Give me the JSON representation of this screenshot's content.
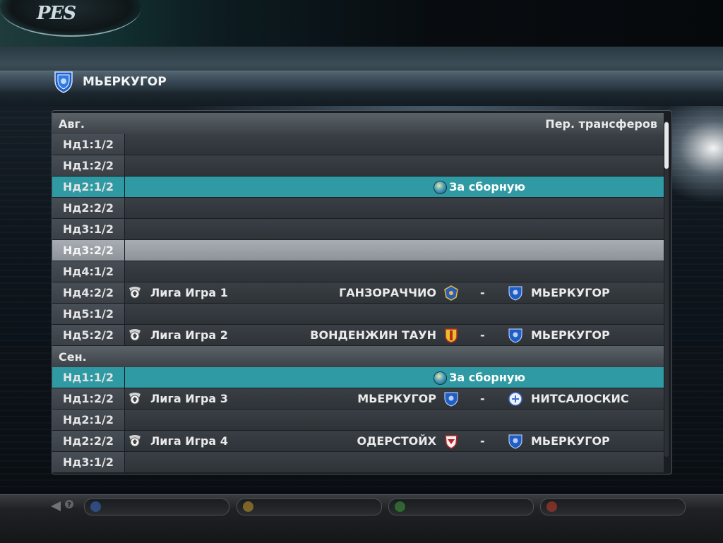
{
  "header": {
    "logo_text": "PES",
    "team_name": "МЬЕРКУГОР"
  },
  "months": [
    {
      "label": "Авг.",
      "window_label": "Пер. трансферов"
    },
    {
      "label": "Сен."
    }
  ],
  "rows": [
    {
      "week": "Нд1:1/2"
    },
    {
      "week": "Нд1:2/2"
    },
    {
      "week": "Нд2:1/2",
      "event": "За сборную",
      "style": "highlight"
    },
    {
      "week": "Нд2:2/2"
    },
    {
      "week": "Нд3:1/2"
    },
    {
      "week": "Нд3:2/2",
      "style": "selected"
    },
    {
      "week": "Нд4:1/2"
    },
    {
      "week": "Нд4:2/2",
      "competition": "Лига Игра 1",
      "home": "ГАНЗОРАЧЧИО",
      "away": "МЬЕРКУГОР"
    },
    {
      "week": "Нд5:1/2"
    },
    {
      "week": "Нд5:2/2",
      "competition": "Лига Игра 2",
      "home": "ВОНДЕНЖИН ТАУН",
      "away": "МЬЕРКУГОР"
    },
    {
      "week": "Нд1:1/2",
      "event": "За сборную",
      "style": "highlight"
    },
    {
      "week": "Нд1:2/2",
      "competition": "Лига Игра 3",
      "home": "МЬЕРКУГОР",
      "away": "НИТСАЛОСКИС"
    },
    {
      "week": "Нд2:1/2"
    },
    {
      "week": "Нд2:2/2",
      "competition": "Лига Игра 4",
      "home": "ОДЕРСТОЙХ",
      "away": "МЬЕРКУГОР"
    },
    {
      "week": "Нд3:1/2"
    }
  ],
  "match_separator": "-",
  "colors": {
    "highlight": "#2f9aa3",
    "selected": "#9aa0a5",
    "row": "#34393e"
  },
  "icons": {
    "national_team": "globe-icon",
    "league": "league-ball-icon"
  },
  "bottom_buttons": [
    {
      "icon": "x-button-icon",
      "color": "#3a6ec8"
    },
    {
      "icon": "y-button-icon",
      "color": "#c89a2a"
    },
    {
      "icon": "a-button-icon",
      "color": "#3f9a3a"
    },
    {
      "icon": "b-button-icon",
      "color": "#c83a2a"
    }
  ]
}
